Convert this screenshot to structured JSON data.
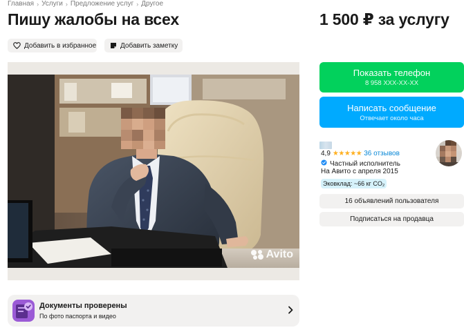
{
  "breadcrumb": [
    "Главная",
    "Услуги",
    "Предложение услуг",
    "Другое"
  ],
  "listing": {
    "title": "Пишу жалобы на всех",
    "price": "1 500 ₽ за услугу"
  },
  "actions": {
    "favorite_label": "Добавить в избранное",
    "note_label": "Добавить заметку"
  },
  "photo": {
    "watermark": "Avito"
  },
  "contact": {
    "phone_label": "Показать телефон",
    "phone_masked": "8 958 XXX-XX-XX",
    "message_label": "Написать сообщение",
    "message_sub": "Отвечает около часа"
  },
  "seller": {
    "rating": "4,9",
    "stars": "★★★★★",
    "reviews": "36 отзывов",
    "type": "Частный исполнитель",
    "since": "На Авито с апреля 2015",
    "eco": "Эковклад: ~66 кг CO₂",
    "ads_button": "16 объявлений пользователя",
    "subscribe_button": "Подписаться на продавца"
  },
  "docs": {
    "title": "Документы проверены",
    "subtitle": "По фото паспорта и видео"
  },
  "colors": {
    "phone_button": "#02d15c",
    "message_button": "#00aaff",
    "stars": "#ffb021",
    "link": "#0a88d6",
    "verified": "#1f8cf5",
    "eco_badge": "#d6f2fb",
    "gray_button": "#f2f1f0"
  },
  "icons": {
    "favorite": "heart-icon",
    "note": "note-icon",
    "verified": "verified-check-icon",
    "docs": "document-check-icon",
    "chevron": "chevron-right-icon",
    "breadcrumb_separator": "chevron-right-icon",
    "watermark": "avito-logo-icon"
  }
}
